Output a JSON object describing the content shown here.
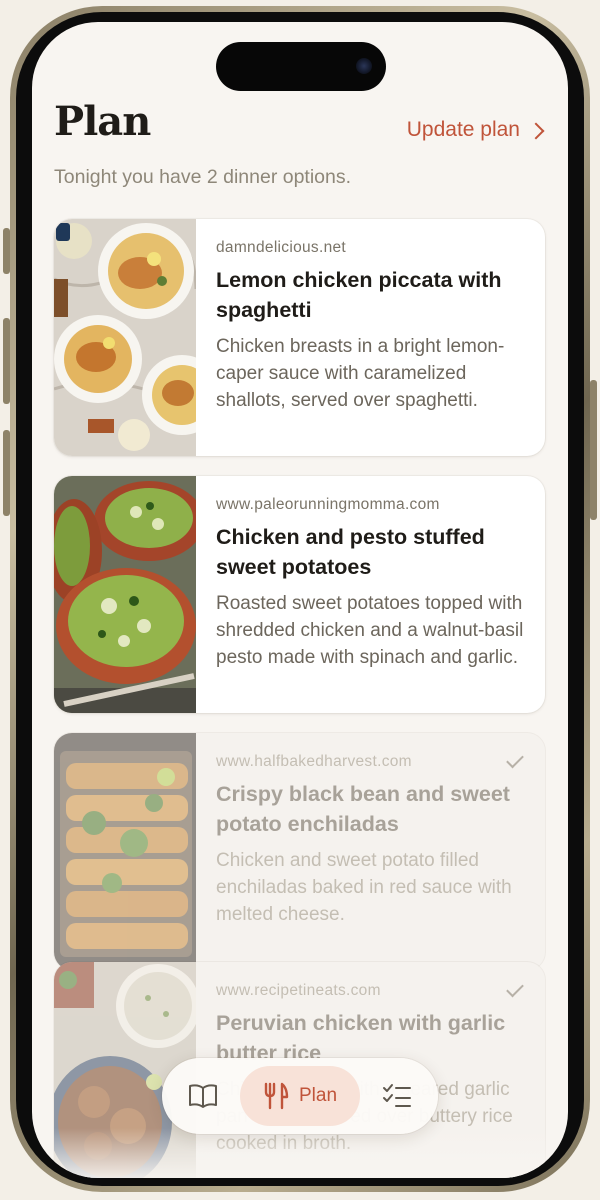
{
  "header": {
    "title": "Plan",
    "update_label": "Update plan",
    "subtitle": "Tonight you have 2 dinner options."
  },
  "recipes": [
    {
      "source": "damndelicious.net",
      "title": "Lemon chicken piccata with spaghetti",
      "description": "Chicken breasts in a bright lemon-caper sauce with caramelized shallots, served over spaghetti.",
      "checked": false
    },
    {
      "source": "www.paleorunningmomma.com",
      "title": "Chicken and pesto stuffed sweet potatoes",
      "description": "Roasted sweet potatoes topped with shredded chicken and a walnut-basil pesto made with spinach and garlic.",
      "checked": false
    },
    {
      "source": "www.halfbakedharvest.com",
      "title": "Crispy black bean and sweet potato enchiladas",
      "description": "Chicken and sweet potato filled enchiladas baked in red sauce with melted cheese.",
      "checked": true
    },
    {
      "source": "www.recipetineats.com",
      "title": "Peruvian chicken with garlic butter rice",
      "description": "Chicken thighs with a seared garlic pan sauce, served over buttery rice cooked in broth.",
      "checked": true
    }
  ],
  "tabbar": {
    "items": [
      {
        "icon": "book-open-icon"
      },
      {
        "icon": "fork-knife-icon",
        "label": "Plan",
        "active": true
      },
      {
        "icon": "checklist-icon"
      }
    ]
  },
  "colors": {
    "accent": "#c0543a",
    "accent_soft": "#f8e2d8",
    "background": "#f8f5f1",
    "text_primary": "#1f1c18",
    "text_muted": "#8e8779"
  }
}
